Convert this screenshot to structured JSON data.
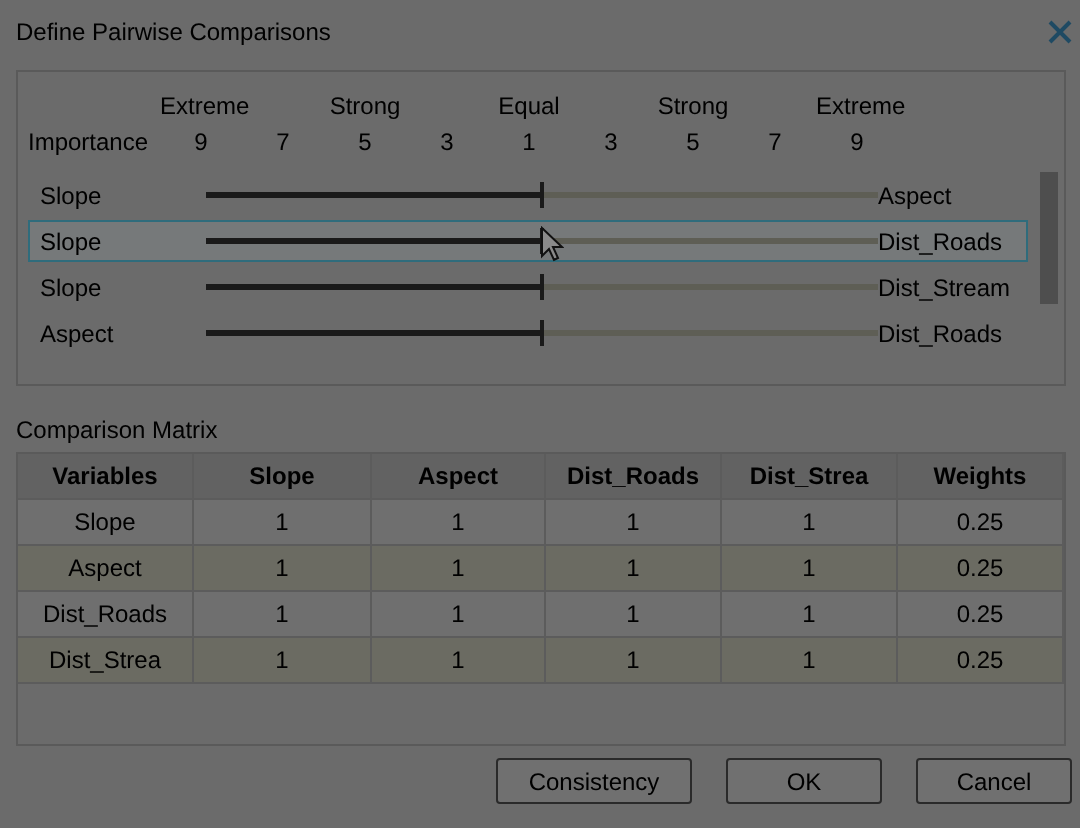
{
  "window": {
    "title": "Define Pairwise Comparisons"
  },
  "scale": {
    "row_label": "Importance",
    "strength_labels": [
      "Extreme",
      "Strong",
      "Equal",
      "Strong",
      "Extreme"
    ],
    "values": [
      "9",
      "7",
      "5",
      "3",
      "1",
      "3",
      "5",
      "7",
      "9"
    ]
  },
  "comparisons": [
    {
      "left": "Slope",
      "right": "Aspect",
      "level": 0.5,
      "selected": false
    },
    {
      "left": "Slope",
      "right": "Dist_Roads",
      "level": 0.5,
      "selected": true
    },
    {
      "left": "Slope",
      "right": "Dist_Stream",
      "level": 0.5,
      "selected": false
    },
    {
      "left": "Aspect",
      "right": "Dist_Roads",
      "level": 0.5,
      "selected": false
    }
  ],
  "matrix": {
    "title": "Comparison Matrix",
    "columns": [
      "Variables",
      "Slope",
      "Aspect",
      "Dist_Roads",
      "Dist_Strea",
      "Weights"
    ],
    "rows": [
      [
        "Slope",
        "1",
        "1",
        "1",
        "1",
        "0.25"
      ],
      [
        "Aspect",
        "1",
        "1",
        "1",
        "1",
        "0.25"
      ],
      [
        "Dist_Roads",
        "1",
        "1",
        "1",
        "1",
        "0.25"
      ],
      [
        "Dist_Strea",
        "1",
        "1",
        "1",
        "1",
        "0.25"
      ]
    ]
  },
  "buttons": [
    "Consistency",
    "OK",
    "Cancel"
  ]
}
